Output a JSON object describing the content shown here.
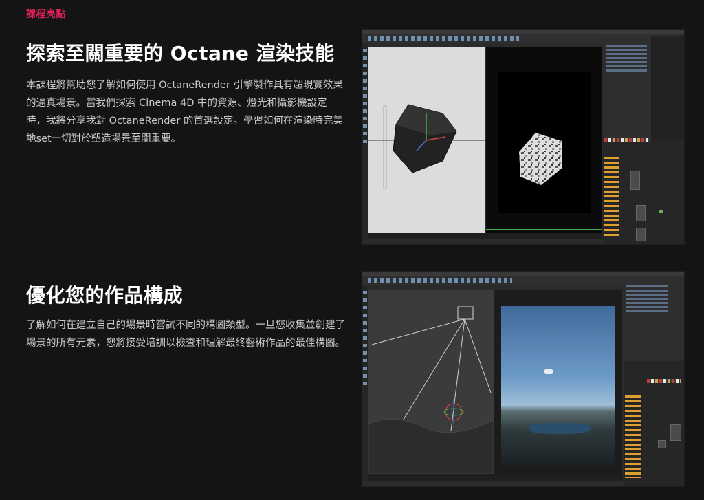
{
  "eyebrow": "課程亮點",
  "sections": [
    {
      "title": "探索至關重要的 Octane 渲染技能",
      "body": "本課程將幫助您了解如何使用 OctaneRender 引擎製作具有超現實效果的逼真場景。當我們探索 Cinema 4D 中的資源、燈光和攝影機設定時，我將分享我對 OctaneRender 的首選設定。學習如何在渲染時完美地set一切對於塑造場景至關重要。"
    },
    {
      "title": "優化您的作品構成",
      "body": "了解如何在建立自己的場景時嘗試不同的構圖類型。一旦您收集並創建了場景的所有元素，您將接受培訓以檢查和理解最終藝術作品的最佳構圖。"
    }
  ],
  "colors": {
    "accent": "#e5235a",
    "background": "#151414"
  },
  "screenshots": [
    {
      "name": "cinema4d-octane-cube-screenshot"
    },
    {
      "name": "cinema4d-octane-landscape-screenshot"
    }
  ]
}
